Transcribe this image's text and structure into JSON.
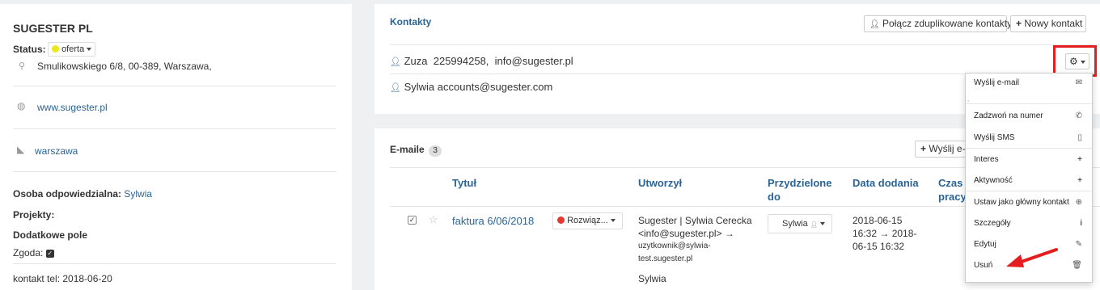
{
  "company": {
    "name": "SUGESTER PL",
    "status_label": "Status:",
    "status_value": "oferta",
    "address": "Smulikowskiego 6/8, 00-389, Warszawa,",
    "website": "www.sugester.pl",
    "tag": "warszawa",
    "owner_label": "Osoba odpowiedzialna:",
    "owner_value": "Sylwia",
    "projects_label": "Projekty:",
    "extra_field_label": "Dodatkowe pole",
    "consent_label": "Zgoda:",
    "contact_tel": "kontakt tel: 2018-06-20"
  },
  "contacts": {
    "title": "Kontakty",
    "merge_button": "Połącz zduplikowane kontakty",
    "new_button": "Nowy kontakt",
    "items": [
      {
        "name": "Zuza",
        "phone": "225994258,",
        "email": "info@sugester.pl"
      },
      {
        "name": "Sylwia",
        "email": "accounts@sugester.com"
      }
    ]
  },
  "emails": {
    "title": "E-maile",
    "count": "3",
    "send_button": "Wyślij e-",
    "columns": [
      "Tytuł",
      "Utworzył",
      "Przydzielone do",
      "Data dodania",
      "Czas pracy"
    ],
    "row": {
      "title": "faktura 6/06/2018",
      "status": "Rozwiąz...",
      "creator_line1": "Sugester | Sylwia Cerecka",
      "creator_line2": "<info@sugester.pl> →",
      "creator_line3": "uzytkownik@sylwia-",
      "creator_line4": "test.sugester.pl",
      "creator_line5": "Sylwia",
      "assigned": "Sylwia",
      "date_line1": "2018-06-15",
      "date_line2": "16:32 → 2018-",
      "date_line3": "06-15 16:32"
    }
  },
  "menu": {
    "items": [
      {
        "label": "Wyślij e-mail",
        "icon": "envelope-icon"
      },
      {
        "label": "Zadzwoń na numer",
        "icon": "phone-icon"
      },
      {
        "label": "Wyślij SMS",
        "icon": "mobile-icon"
      },
      {
        "label": "Interes",
        "icon": "plus-icon"
      },
      {
        "label": "Aktywność",
        "icon": "plus-icon"
      },
      {
        "label": "Ustaw jako główny kontakt",
        "icon": "circle-plus-icon"
      },
      {
        "label": "Szczegóły",
        "icon": "info-icon"
      },
      {
        "label": "Edytuj",
        "icon": "pencil-icon"
      },
      {
        "label": "Usuń",
        "icon": "trash-icon"
      }
    ]
  },
  "colors": {
    "link": "#2a6496",
    "highlight": "#e41e1e",
    "status_dot": "#e8e81a",
    "resolved_dot": "#e23b2e"
  }
}
